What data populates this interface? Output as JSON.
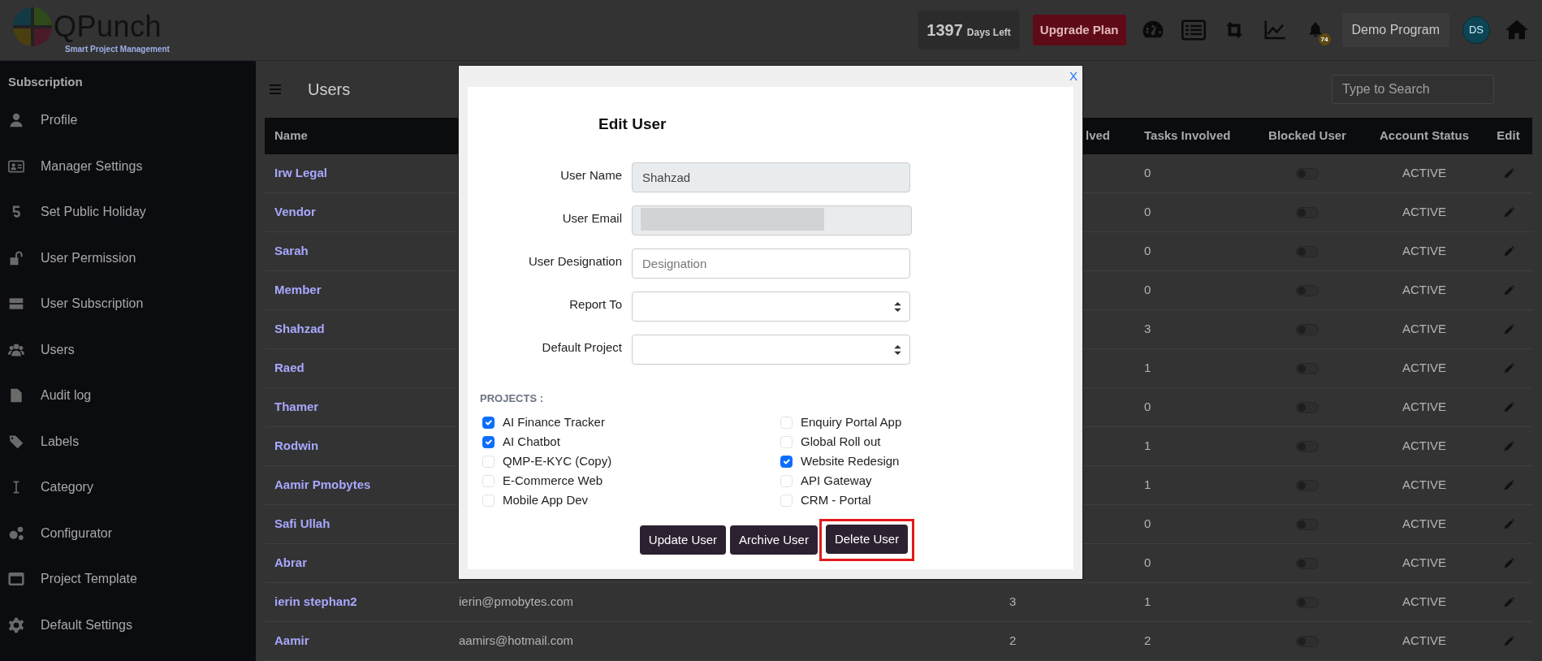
{
  "header": {
    "logo_text": "QPunch",
    "tagline": "Smart Project Management",
    "days_count": "1397",
    "days_label": "Days Left",
    "upgrade_button": "Upgrade Plan",
    "toolbar_icons": [
      {
        "kind": "gauge"
      },
      {
        "kind": "list"
      },
      {
        "kind": "retweet"
      },
      {
        "kind": "chart"
      },
      {
        "kind": "bell",
        "badge": "74"
      }
    ],
    "program_button": "Demo Program",
    "avatar": "DS"
  },
  "sidebar": {
    "heading": "Subscription",
    "items": [
      {
        "label": "Profile",
        "kind": "user"
      },
      {
        "label": "Manager Settings",
        "kind": "idcard"
      },
      {
        "label": "Set Public Holiday",
        "kind": "holiday"
      },
      {
        "label": "User Permission",
        "kind": "unlock"
      },
      {
        "label": "User Subscription",
        "kind": "server"
      },
      {
        "label": "Users",
        "kind": "users"
      },
      {
        "label": "Audit log",
        "kind": "file"
      },
      {
        "label": "Labels",
        "kind": "tags"
      },
      {
        "label": "Category",
        "kind": "cursor"
      },
      {
        "label": "Configurator",
        "kind": "cogs"
      },
      {
        "label": "Project Template",
        "kind": "window"
      },
      {
        "label": "Default Settings",
        "kind": "gear"
      }
    ]
  },
  "page": {
    "title": "Users",
    "search_placeholder": "Type to Search"
  },
  "table": {
    "headers": {
      "name": "Name",
      "column_3": "lved",
      "tasks": "Tasks Involved",
      "blocked": "Blocked User",
      "status": "Account Status",
      "edit": "Edit"
    },
    "rows": [
      {
        "name": "Irw Legal",
        "tasks": "0",
        "blocked": false,
        "status": "ACTIVE"
      },
      {
        "name": "Vendor",
        "tasks": "0",
        "blocked": false,
        "status": "ACTIVE"
      },
      {
        "name": "Sarah",
        "tasks": "0",
        "blocked": false,
        "status": "ACTIVE"
      },
      {
        "name": "Member",
        "tasks": "0",
        "blocked": false,
        "status": "ACTIVE"
      },
      {
        "name": "Shahzad",
        "tasks": "3",
        "blocked": false,
        "status": "ACTIVE"
      },
      {
        "name": "Raed",
        "tasks": "1",
        "blocked": false,
        "status": "ACTIVE"
      },
      {
        "name": "Thamer",
        "tasks": "0",
        "blocked": false,
        "status": "ACTIVE"
      },
      {
        "name": "Rodwin",
        "tasks": "1",
        "blocked": false,
        "status": "ACTIVE"
      },
      {
        "name": "Aamir Pmobytes",
        "tasks": "1",
        "blocked": false,
        "status": "ACTIVE"
      },
      {
        "name": "Safi Ullah",
        "tasks": "0",
        "blocked": false,
        "status": "ACTIVE"
      },
      {
        "name": "Abrar",
        "tasks": "0",
        "blocked": false,
        "status": "ACTIVE"
      },
      {
        "name": "ierin stephan2",
        "email": "ierin@pmobytes.com",
        "column_3": "3",
        "tasks": "1",
        "blocked": false,
        "status": "ACTIVE"
      },
      {
        "name": "Aamir",
        "email": "aamirs@hotmail.com",
        "column_3": "2",
        "tasks": "2",
        "blocked": false,
        "status": "ACTIVE"
      }
    ]
  },
  "modal": {
    "close": "X",
    "title": "Edit User",
    "fields": [
      {
        "label": "User Name",
        "kind": "text",
        "value": "Shahzad",
        "disabled": true
      },
      {
        "label": "User Email",
        "kind": "redacted",
        "disabled": true
      },
      {
        "label": "User Designation",
        "kind": "text",
        "placeholder": "Designation",
        "disabled": false
      },
      {
        "label": "Report To",
        "kind": "select",
        "disabled": false
      },
      {
        "label": "Default Project",
        "kind": "select",
        "disabled": false
      }
    ],
    "projects_label": "PROJECTS :",
    "projects": [
      {
        "label": "AI Finance Tracker",
        "checked": true
      },
      {
        "label": "AI Chatbot",
        "checked": true
      },
      {
        "label": "QMP-E-KYC (Copy)",
        "checked": false
      },
      {
        "label": "E-Commerce Web",
        "checked": false
      },
      {
        "label": "Mobile App Dev",
        "checked": false
      },
      {
        "label": "Enquiry Portal App",
        "checked": false
      },
      {
        "label": "Global Roll out",
        "checked": false
      },
      {
        "label": "Website Redesign",
        "checked": true
      },
      {
        "label": "API Gateway",
        "checked": false
      },
      {
        "label": "CRM - Portal",
        "checked": false
      }
    ],
    "buttons": [
      {
        "label": "Update User",
        "highlighted": false
      },
      {
        "label": "Archive User",
        "highlighted": false
      },
      {
        "label": "Delete User",
        "highlighted": true
      }
    ]
  }
}
